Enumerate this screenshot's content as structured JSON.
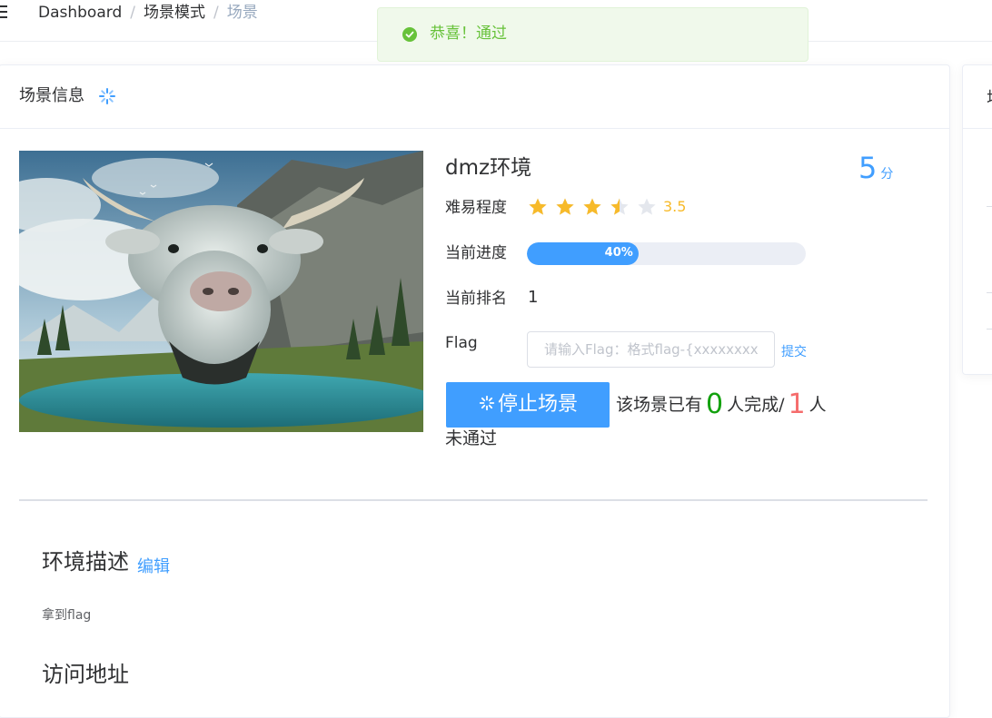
{
  "breadcrumb": {
    "items": [
      "Dashboard",
      "场景模式",
      "场景"
    ],
    "separator": "/"
  },
  "toast": {
    "message": "恭喜！通过",
    "type": "success"
  },
  "card": {
    "title": "场景信息"
  },
  "side_card": {
    "title": "场"
  },
  "scene": {
    "name": "dmz环境",
    "score_value": "5",
    "score_unit": "分",
    "difficulty_label": "难易程度",
    "rating": 3.5,
    "rating_text": "3.5",
    "progress_label": "当前进度",
    "progress": 40,
    "progress_text": "40%",
    "rank_label": "当前排名",
    "rank_value": "1",
    "flag_label": "Flag",
    "flag_placeholder": "请输入Flag：格式flag-{xxxxxxxx}",
    "submit_label": "提交",
    "stop_button": "停止场景",
    "stats": {
      "prefix": "该场景已有",
      "completed": "0",
      "completed_suffix": "人完成/",
      "failed": "1",
      "failed_suffix": "人",
      "failed_wrap": "未通过"
    }
  },
  "description": {
    "title": "环境描述",
    "edit_label": "编辑",
    "text": "拿到flag"
  },
  "access": {
    "title": "访问地址"
  },
  "colors": {
    "primary": "#409eff",
    "success": "#67c23a",
    "star": "#f7ba2a",
    "danger": "#f56c6c",
    "complete": "#13a10e"
  },
  "icons": [
    "menu-icon",
    "success-check-icon",
    "loading-icon",
    "star-icon",
    "scene-image"
  ]
}
